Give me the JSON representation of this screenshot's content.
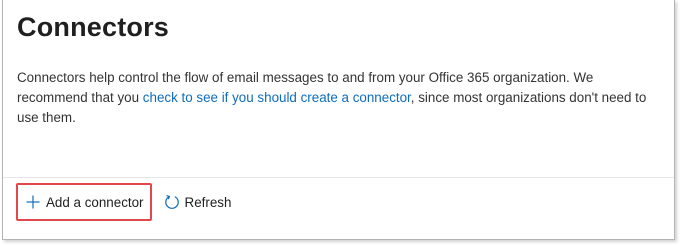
{
  "page": {
    "title": "Connectors",
    "description": {
      "before": "Connectors help control the flow of email messages to and from your Office 365 organization. We recommend that you ",
      "link": "check to see if you should create a connector",
      "after": ", since most organizations don't need to use them."
    }
  },
  "toolbar": {
    "add_label": "Add a connector",
    "add_icon": "plus-icon",
    "refresh_label": "Refresh",
    "refresh_icon": "refresh-icon"
  },
  "colors": {
    "link": "#0f6cbd",
    "highlight": "#e0484c",
    "icon": "#0f6cbd"
  }
}
